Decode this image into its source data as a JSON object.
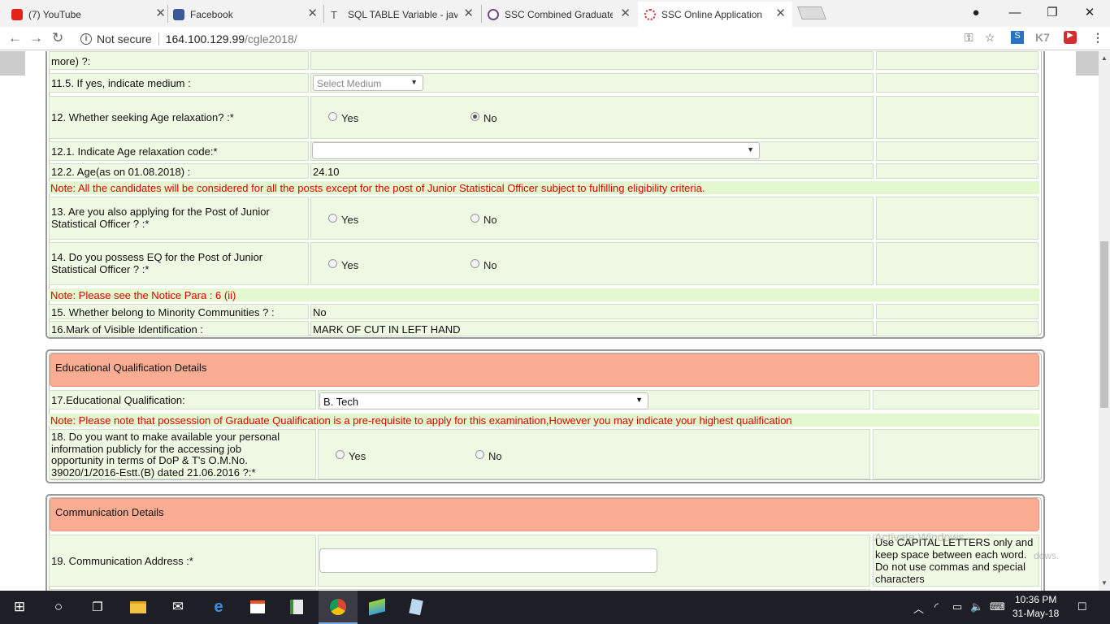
{
  "browser": {
    "tabs": [
      {
        "title": "(7) YouTube",
        "icon": "youtube-icon",
        "color": "#e62117"
      },
      {
        "title": "Facebook",
        "icon": "facebook-icon",
        "color": "#3b5998"
      },
      {
        "title": "SQL TABLE Variable - java",
        "icon": "sql-tab-icon",
        "color": "#555555"
      },
      {
        "title": "SSC Combined Graduate",
        "icon": "ssc-tab-icon",
        "color": "#6a4a8a"
      },
      {
        "title": "SSC Online Application",
        "icon": "loading-icon",
        "color": "#d32f2f"
      }
    ],
    "address": {
      "security": "Not secure",
      "host": "164.100.129.99",
      "path": "/cgle2018/"
    }
  },
  "form": {
    "row_11_4_tail": "more) ?:",
    "row_11_5": {
      "label": "11.5. If yes, indicate medium :",
      "select_value": "Select Medium"
    },
    "row_12": {
      "label": "12. Whether seeking Age relaxation? :*",
      "opt_yes": "Yes",
      "opt_no": "No",
      "selected": "No"
    },
    "row_12_1": {
      "label": "12.1. Indicate Age relaxation code:*",
      "select_value": ""
    },
    "row_12_2": {
      "label": "12.2. Age(as on 01.08.2018) :",
      "value": "24.10"
    },
    "note_1": "Note: All the candidates will be considered for all the posts except for the post of Junior Statistical Officer subject to fulfilling eligibility criteria.",
    "row_13": {
      "label_1": "13. Are you also applying for the Post of Junior",
      "label_2": "Statistical Officer ? :*",
      "opt_yes": "Yes",
      "opt_no": "No"
    },
    "row_14": {
      "label_1": "14. Do you possess EQ for the Post of Junior",
      "label_2": "Statistical Officer ? :*",
      "opt_yes": "Yes",
      "opt_no": "No"
    },
    "note_2": "Note: Please see the Notice Para : 6 (ii)",
    "row_15": {
      "label": "15. Whether belong to Minority Communities ? :",
      "value": "No"
    },
    "row_16": {
      "label": "16.Mark of Visible Identification :",
      "value": "MARK OF CUT IN LEFT HAND"
    }
  },
  "education": {
    "header": "Educational Qualification Details",
    "row_17": {
      "label": "17.Educational Qualification:",
      "select_value": "B. Tech"
    },
    "note": "Note: Please note that possession of Graduate Qualification is a pre-requisite to apply for this examination,However you may indicate your highest qualification",
    "row_18": {
      "line_1": "18. Do you want to make available your personal",
      "line_2": "information publicly for the accessing job",
      "line_3": "opportunity in terms of DoP & T's O.M.No.",
      "line_4": "39020/1/2016-Estt.(B) dated 21.06.2016 ?:*",
      "opt_yes": "Yes",
      "opt_no": "No"
    }
  },
  "communication": {
    "header": "Communication Details",
    "row_19": {
      "label": "19. Communication Address :*",
      "value": ""
    },
    "hint_1": "Use CAPITAL LETTERS only and",
    "hint_2": "keep space between each word.",
    "hint_3": "Do not use commas and special",
    "hint_4": "characters",
    "watermark_1": "Activate Windows",
    "watermark_2": "dows."
  },
  "taskbar": {
    "time": "10:36 PM",
    "date": "31-May-18"
  }
}
